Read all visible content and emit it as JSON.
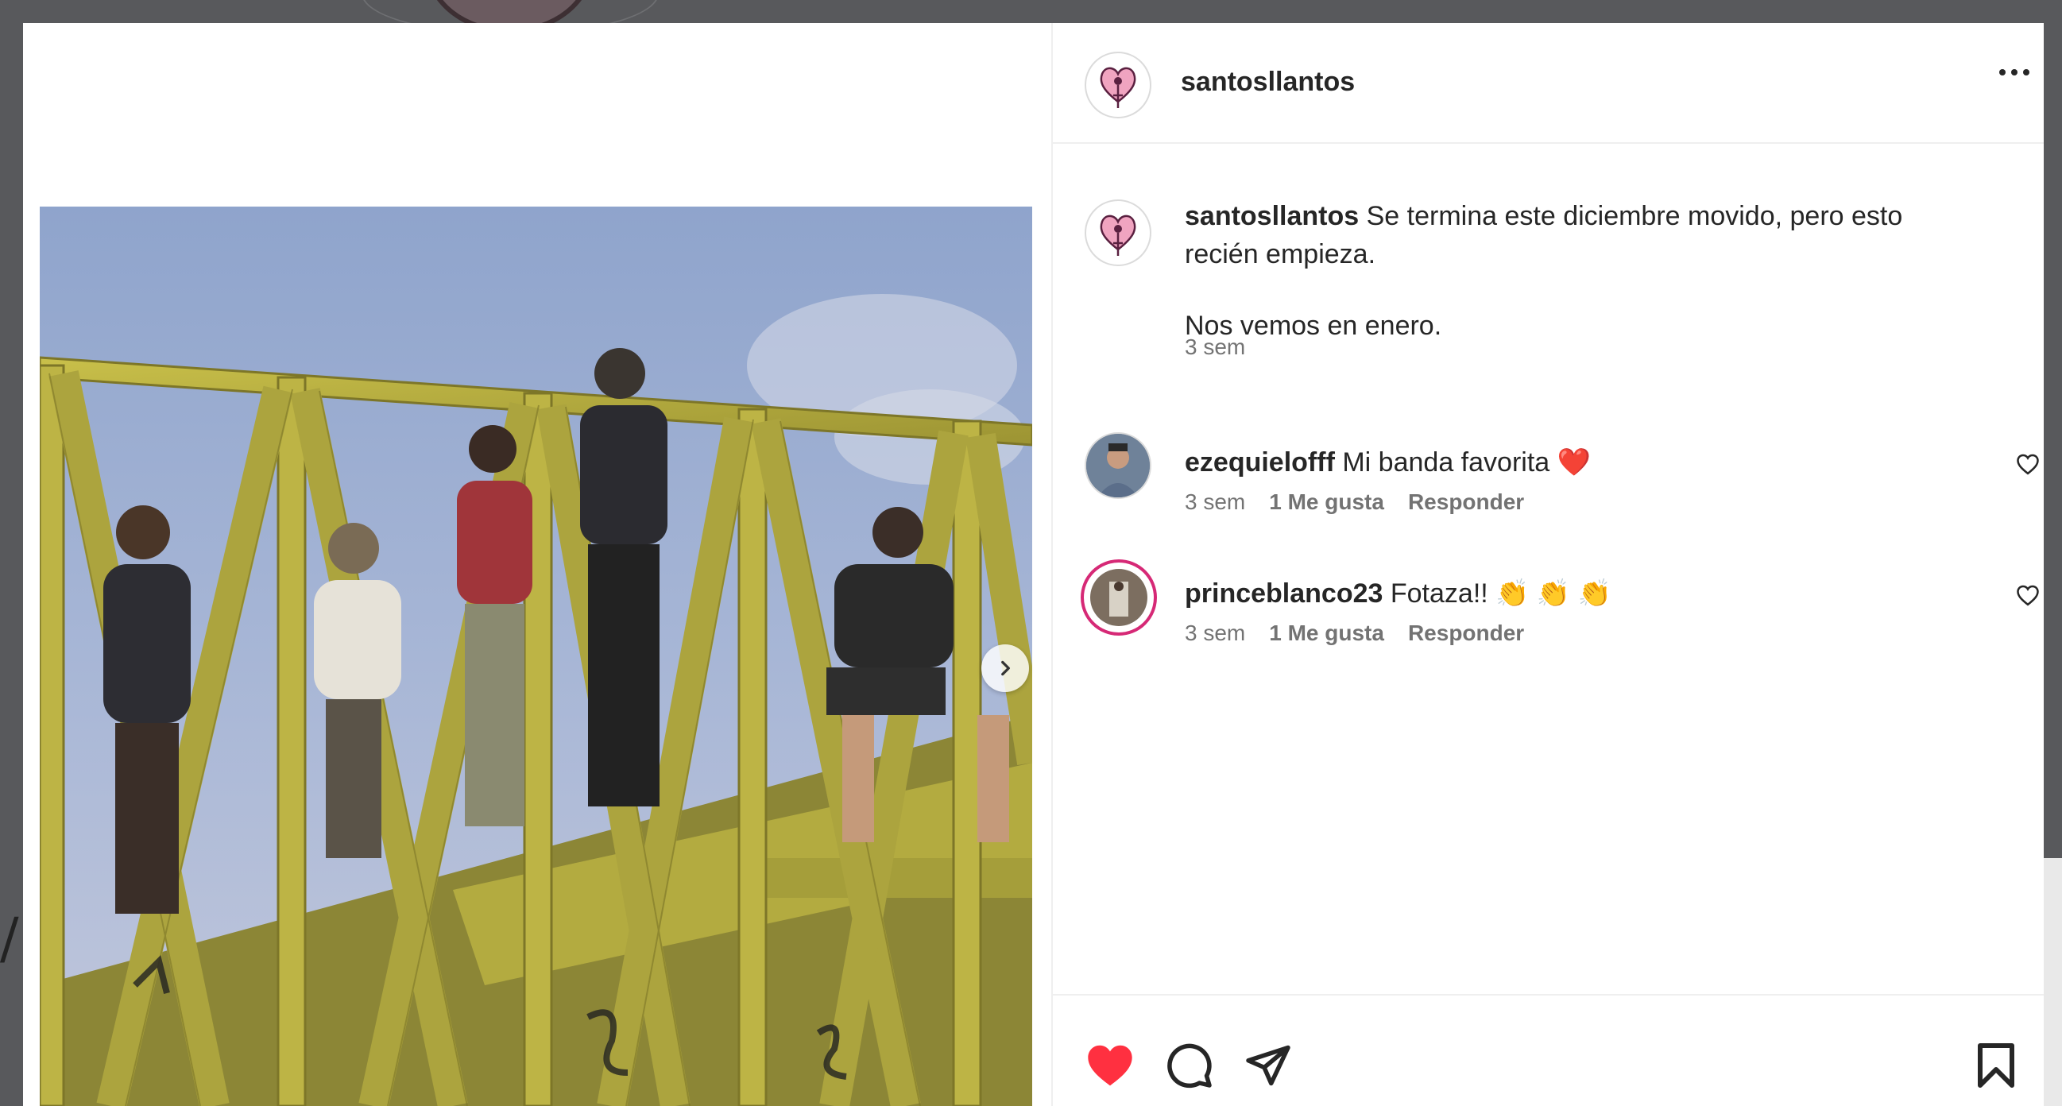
{
  "post": {
    "author": "santosllantos",
    "caption_line1": "Se termina este diciembre movido, pero esto recién empieza.",
    "caption_line2": "Nos vemos en enero.",
    "caption_time": "3 sem"
  },
  "comments": [
    {
      "user": "ezequielofff",
      "text": "Mi banda favorita ",
      "emoji": "❤️",
      "time": "3 sem",
      "likes": "1 Me gusta",
      "reply": "Responder"
    },
    {
      "user": "princeblanco23",
      "text": "Fotaza!! ",
      "emoji": "👏 👏 👏",
      "time": "3 sem",
      "likes": "1 Me gusta",
      "reply": "Responder"
    }
  ],
  "background": {
    "fragment": "/("
  },
  "icons": {
    "like": "heart-filled-icon",
    "comment": "comment-bubble-icon",
    "share": "paper-plane-icon",
    "save": "bookmark-icon",
    "more": "more-options-icon",
    "next": "chevron-right-icon"
  },
  "colors": {
    "like_red": "#ff3040",
    "text": "#262626",
    "muted": "#737373",
    "story_ring": "#d62976"
  }
}
